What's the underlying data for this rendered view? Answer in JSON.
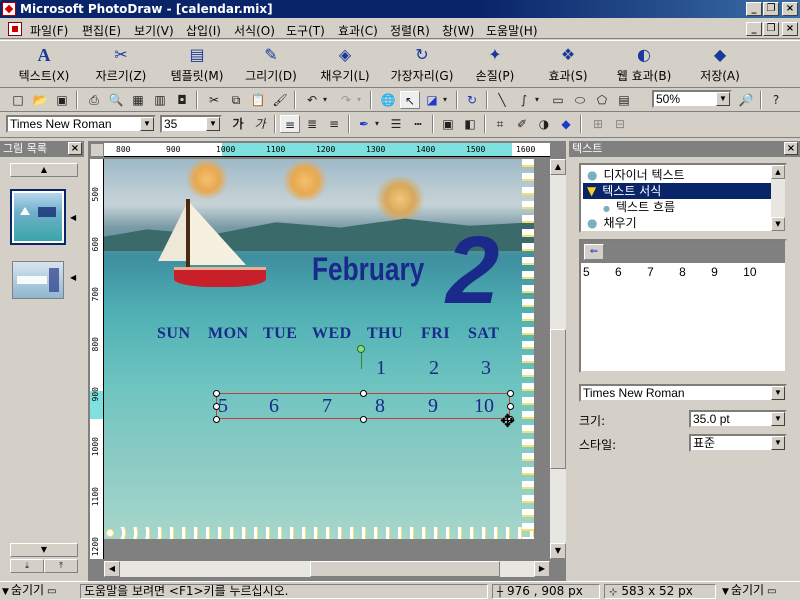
{
  "window": {
    "title": "Microsoft PhotoDraw - [calendar.mix]"
  },
  "menu": [
    "파일(F)",
    "편집(E)",
    "보기(V)",
    "삽입(I)",
    "서식(O)",
    "도구(T)",
    "효과(C)",
    "정렬(R)",
    "창(W)",
    "도움말(H)"
  ],
  "bigbar": [
    {
      "label": "텍스트(X)",
      "icon": "A"
    },
    {
      "label": "자르기(Z)",
      "icon": "✂"
    },
    {
      "label": "템플릿(M)",
      "icon": "▤"
    },
    {
      "label": "그리기(D)",
      "icon": "✎"
    },
    {
      "label": "채우기(L)",
      "icon": "◈"
    },
    {
      "label": "가장자리(G)",
      "icon": "↻"
    },
    {
      "label": "손질(P)",
      "icon": "✦"
    },
    {
      "label": "효과(S)",
      "icon": "❖"
    },
    {
      "label": "웹 효과(B)",
      "icon": "◐"
    },
    {
      "label": "저장(A)",
      "icon": "◆"
    }
  ],
  "zoom": {
    "value": "50%"
  },
  "font": {
    "name": "Times New Roman",
    "size": "35"
  },
  "left_panel": {
    "title": "그림 목록"
  },
  "ruler": {
    "h": [
      "800",
      "900",
      "1000",
      "1100",
      "1200",
      "1300",
      "1400",
      "1500",
      "1600"
    ],
    "v": [
      "500",
      "600",
      "700",
      "800",
      "900",
      "1000",
      "1100",
      "1200"
    ]
  },
  "calendar": {
    "month": "February",
    "month_number": "2",
    "days": [
      "SUN",
      "MON",
      "TUE",
      "WED",
      "THU",
      "FRI",
      "SAT"
    ],
    "row1": [
      "1",
      "2",
      "3"
    ],
    "row2": [
      "5",
      "6",
      "7",
      "8",
      "9",
      "10"
    ]
  },
  "right_panel": {
    "title": "텍스트",
    "tree": [
      "디자이너 텍스트",
      "텍스트 서식",
      "텍스트 흐름",
      "채우기"
    ],
    "preview_text": [
      "5",
      "6",
      "7",
      "8",
      "9",
      "10"
    ],
    "font_name": "Times New Roman",
    "size_label": "크기:",
    "size_value": "35.0 pt",
    "style_label": "스타일:",
    "style_value": "표준"
  },
  "status": {
    "hide_left": "숨기기",
    "help": "도움말을 보려면 <F1>키를 누르십시오.",
    "coords": "976 , 908  px",
    "size": "583 x 52  px",
    "hide_right": "숨기기"
  }
}
